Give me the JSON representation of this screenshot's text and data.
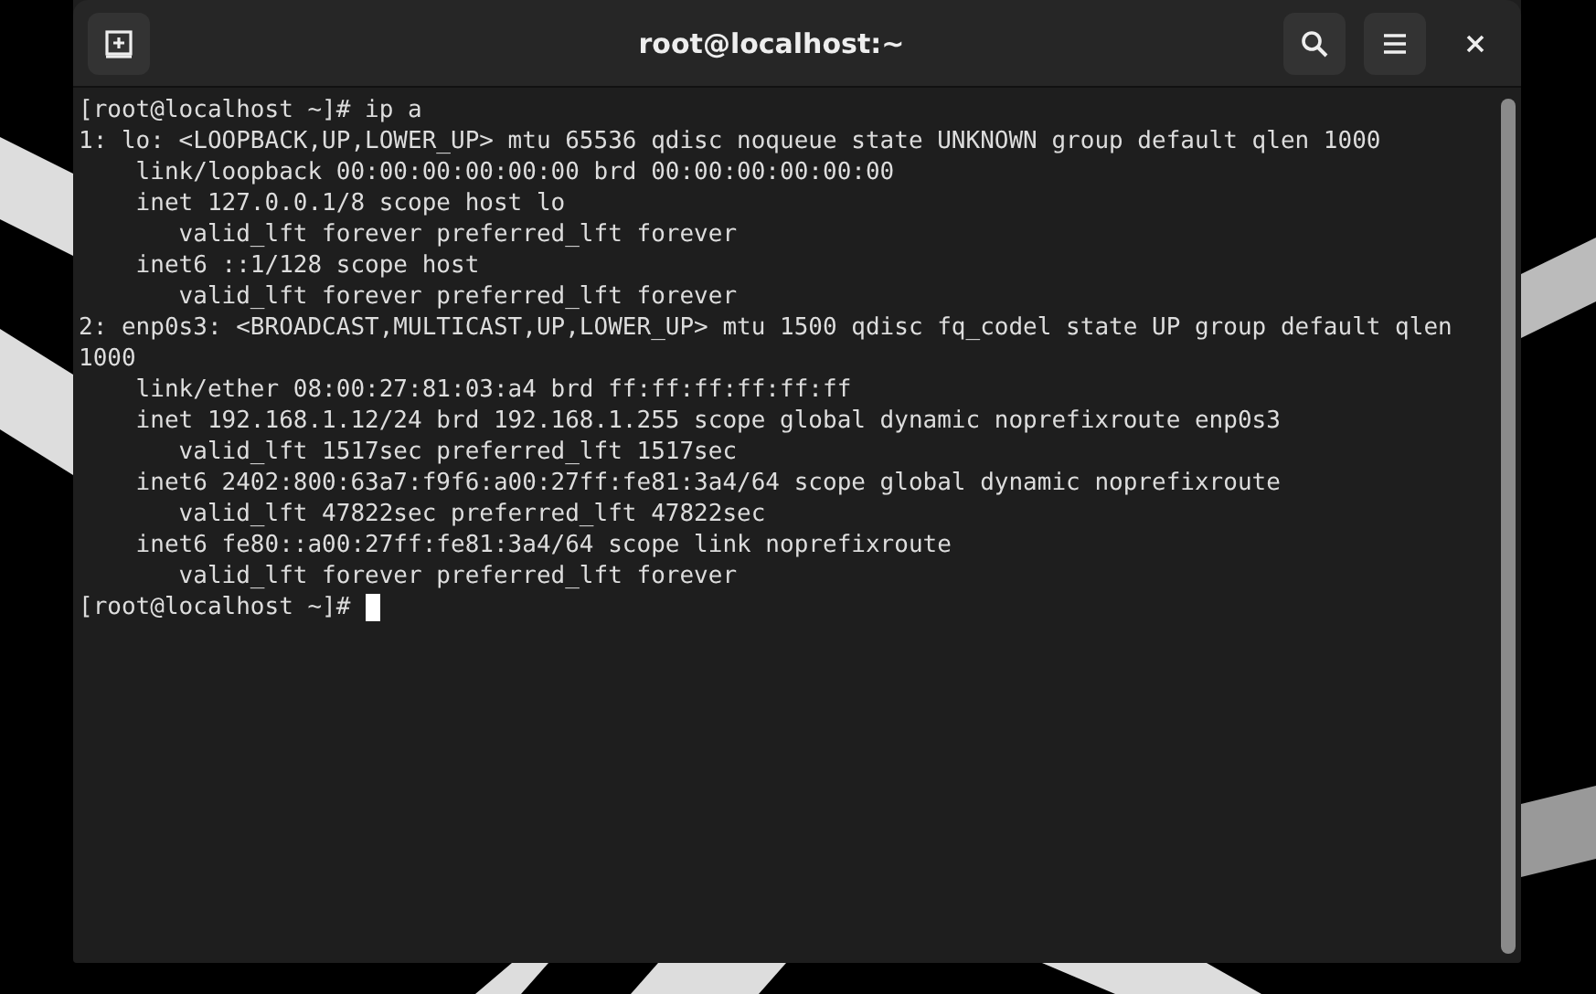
{
  "window": {
    "title": "root@localhost:~"
  },
  "terminal": {
    "lines": [
      "[root@localhost ~]# ip a",
      "1: lo: <LOOPBACK,UP,LOWER_UP> mtu 65536 qdisc noqueue state UNKNOWN group default qlen 1000",
      "    link/loopback 00:00:00:00:00:00 brd 00:00:00:00:00:00",
      "    inet 127.0.0.1/8 scope host lo",
      "       valid_lft forever preferred_lft forever",
      "    inet6 ::1/128 scope host",
      "       valid_lft forever preferred_lft forever",
      "2: enp0s3: <BROADCAST,MULTICAST,UP,LOWER_UP> mtu 1500 qdisc fq_codel state UP group default qlen",
      "1000",
      "    link/ether 08:00:27:81:03:a4 brd ff:ff:ff:ff:ff:ff",
      "    inet 192.168.1.12/24 brd 192.168.1.255 scope global dynamic noprefixroute enp0s3",
      "       valid_lft 1517sec preferred_lft 1517sec",
      "    inet6 2402:800:63a7:f9f6:a00:27ff:fe81:3a4/64 scope global dynamic noprefixroute",
      "       valid_lft 47822sec preferred_lft 47822sec",
      "    inet6 fe80::a00:27ff:fe81:3a4/64 scope link noprefixroute",
      "       valid_lft forever preferred_lft forever"
    ],
    "prompt": "[root@localhost ~]#"
  }
}
